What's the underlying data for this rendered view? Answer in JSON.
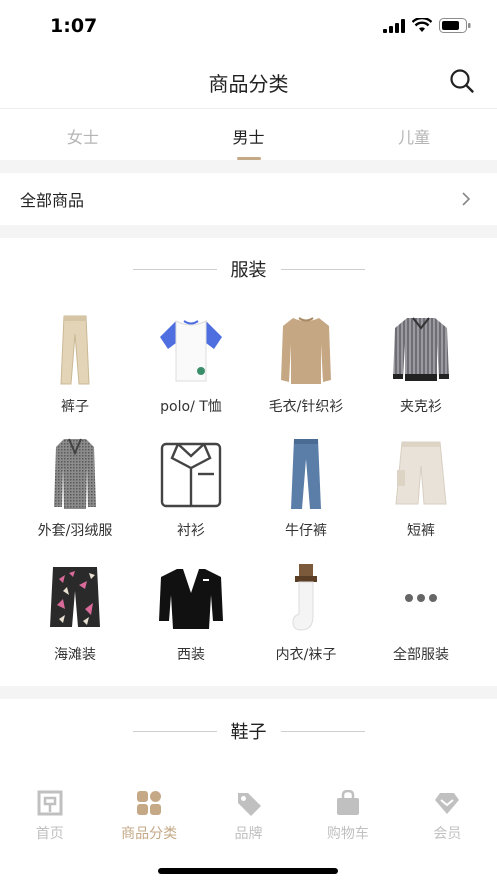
{
  "status": {
    "time": "1:07"
  },
  "nav": {
    "title": "商品分类",
    "search_icon": "search-icon"
  },
  "tabs": [
    {
      "label": "女士",
      "active": false
    },
    {
      "label": "男士",
      "active": true
    },
    {
      "label": "儿童",
      "active": false
    }
  ],
  "all_goods": {
    "label": "全部商品"
  },
  "section_clothing": {
    "heading": "服装",
    "items": [
      {
        "label": "裤子",
        "icon": "trousers"
      },
      {
        "label": "polo/ T恤",
        "icon": "polo-tshirt"
      },
      {
        "label": "毛衣/针织衫",
        "icon": "sweater"
      },
      {
        "label": "夹克衫",
        "icon": "jacket"
      },
      {
        "label": "外套/羽绒服",
        "icon": "coat"
      },
      {
        "label": "衬衫",
        "icon": "shirt"
      },
      {
        "label": "牛仔裤",
        "icon": "jeans"
      },
      {
        "label": "短裤",
        "icon": "shorts"
      },
      {
        "label": "海滩装",
        "icon": "beach-shorts"
      },
      {
        "label": "西装",
        "icon": "suit"
      },
      {
        "label": "内衣/袜子",
        "icon": "socks"
      },
      {
        "label": "全部服装",
        "icon": "more"
      }
    ]
  },
  "section_shoes": {
    "heading": "鞋子"
  },
  "tabbar": [
    {
      "label": "首页",
      "icon": "home-icon",
      "active": false
    },
    {
      "label": "商品分类",
      "icon": "category-icon",
      "active": true
    },
    {
      "label": "品牌",
      "icon": "tag-icon",
      "active": false
    },
    {
      "label": "购物车",
      "icon": "bag-icon",
      "active": false
    },
    {
      "label": "会员",
      "icon": "diamond-icon",
      "active": false
    }
  ],
  "colors": {
    "accent": "#c5a987",
    "inactive": "#c0c0c0",
    "divider": "#f4f4f4"
  }
}
